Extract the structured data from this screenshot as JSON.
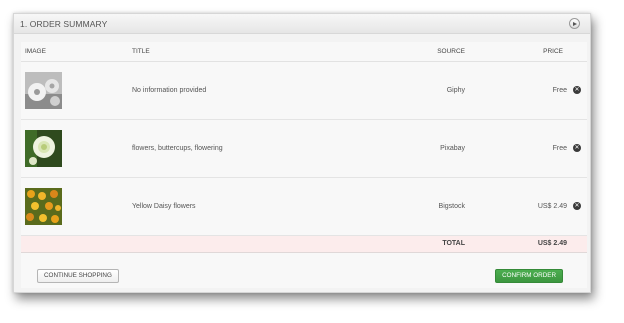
{
  "panel": {
    "title": "1. ORDER SUMMARY"
  },
  "table": {
    "headers": {
      "image": "IMAGE",
      "title": "TITLE",
      "source": "SOURCE",
      "price": "PRICE"
    },
    "rows": [
      {
        "image_icon": "grayscale-flowers-thumbnail",
        "title": "No information provided",
        "source": "Giphy",
        "price": "Free"
      },
      {
        "image_icon": "white-buttercup-thumbnail",
        "title": "flowers, buttercups, flowering",
        "source": "Pixabay",
        "price": "Free"
      },
      {
        "image_icon": "yellow-daisy-thumbnail",
        "title": "Yellow Daisy flowers",
        "source": "Bigstock",
        "price": "US$ 2.49"
      }
    ],
    "total": {
      "label": "TOTAL",
      "value": "US$ 2.49"
    }
  },
  "buttons": {
    "continue": "CONTINUE SHOPPING",
    "confirm": "CONFIRM ORDER"
  },
  "colors": {
    "confirm_bg": "#44a047",
    "total_row_bg": "#fcecec"
  }
}
